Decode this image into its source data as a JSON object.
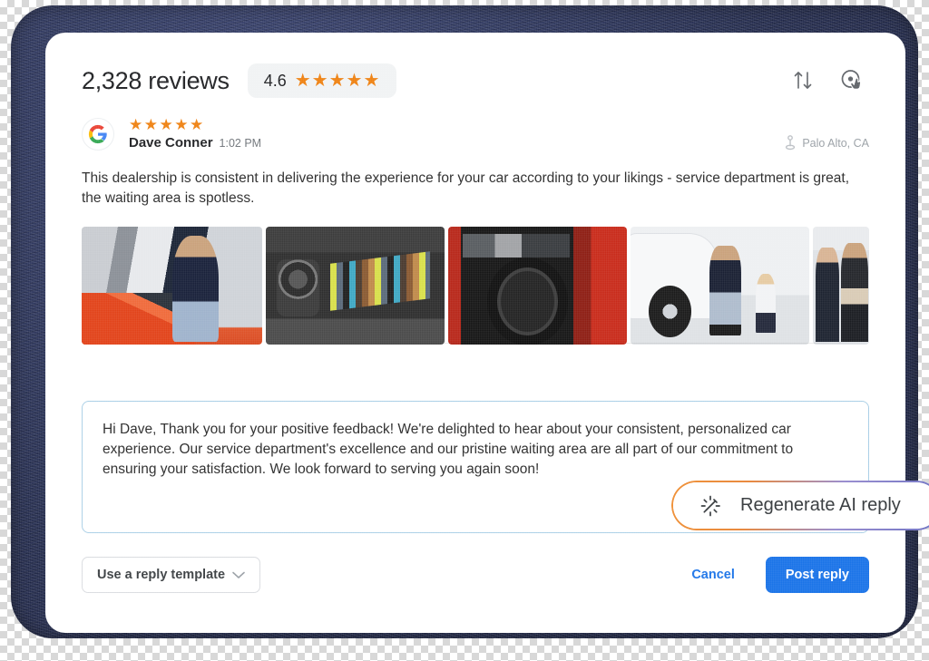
{
  "header": {
    "review_count": "2,328 reviews",
    "rating_value": "4.6",
    "rating_stars": "★★★★★",
    "sort_icon": "sort-arrows-icon",
    "pointer_icon": "target-pointer-icon"
  },
  "review": {
    "source_icon": "google-logo-icon",
    "stars": "★★★★★",
    "author": "Dave Conner",
    "time": "1:02 PM",
    "location": "Palo Alto, CA",
    "location_icon": "location-pin-icon",
    "body": "This dealership is consistent in delivering the experience for your car according to your likings -  service department is great, the waiting area is spotless.",
    "photos": [
      {
        "alt": "woman walking in car showroom next to red sports car"
      },
      {
        "alt": "display wall of colored upholstery swatches and wheel rims"
      },
      {
        "alt": "car interior with steering wheel and dashboard"
      },
      {
        "alt": "woman and child crouching beside white SUV wheel"
      },
      {
        "alt": "two men in suits talking in a dealership"
      }
    ]
  },
  "reply": {
    "text": "Hi Dave, Thank you for your positive feedback! We're delighted to hear about your consistent, personalized car experience. Our service department's excellence and our pristine waiting area are all part of our commitment to ensuring your satisfaction. We look forward to serving you again soon!"
  },
  "regenerate": {
    "label": "Regenerate AI reply",
    "icon": "magic-wand-sparkle-icon"
  },
  "footer": {
    "template_label": "Use a reply template",
    "template_chevron": "chevron-down-icon",
    "cancel_label": "Cancel",
    "post_label": "Post reply"
  },
  "colors": {
    "star": "#ef8212",
    "primary": "#1a73e8",
    "reply_border": "#a9cfe6",
    "frame": "#2a3256",
    "gradient_start": "#f0933b",
    "gradient_end": "#6f74c4"
  }
}
